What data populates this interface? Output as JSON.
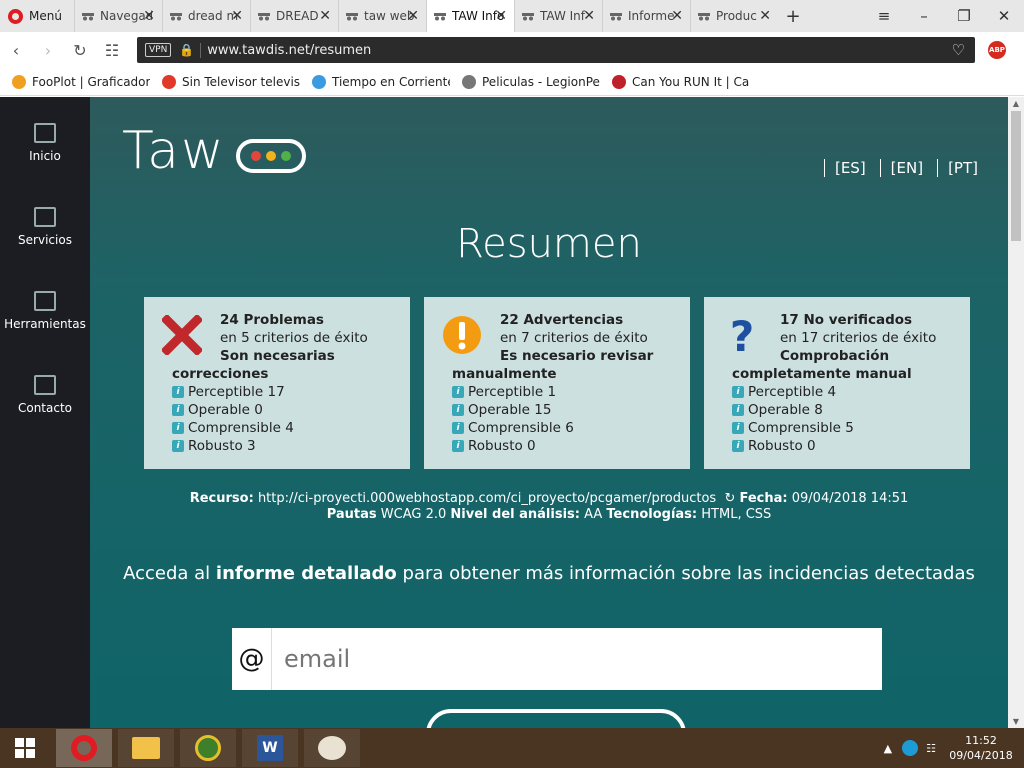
{
  "browser": {
    "menu_label": "Menú",
    "tabs": [
      {
        "title": "Navegador",
        "active": false
      },
      {
        "title": "dread m",
        "active": false
      },
      {
        "title": "DREAD",
        "active": false
      },
      {
        "title": "taw web",
        "active": false
      },
      {
        "title": "TAW Info",
        "active": true
      },
      {
        "title": "TAW Inf",
        "active": false
      },
      {
        "title": "Informe",
        "active": false
      },
      {
        "title": "Produc",
        "active": false
      }
    ],
    "new_tab": "+",
    "url": "www.tawdis.net/resumen",
    "vpn_label": "VPN",
    "abp_label": "ABP",
    "bookmarks": [
      {
        "label": "FooPlot | Graficador d",
        "color": "#f0a020"
      },
      {
        "label": "Sin Televisor televisio",
        "color": "#e23a2a"
      },
      {
        "label": "Tiempo en Corrientes",
        "color": "#3a9be0"
      },
      {
        "label": "Peliculas - LegionPelis",
        "color": "#777777"
      },
      {
        "label": "Can You RUN It | Can",
        "color": "#c0202a"
      }
    ]
  },
  "sidebar": {
    "items": [
      {
        "label": "Inicio"
      },
      {
        "label": "Servicios"
      },
      {
        "label": "Herramientas"
      },
      {
        "label": "Contacto"
      }
    ]
  },
  "logo": {
    "text": "Taw"
  },
  "languages": [
    "[ES]",
    "[EN]",
    "[PT]"
  ],
  "page_title": "Resumen",
  "cards": [
    {
      "icon": "error-x-icon",
      "count_label": "24 Problemas",
      "criteria_label": "en 5 criterios de éxito",
      "note_line1": "Son necesarias",
      "note_line2": "correcciones",
      "criteria": [
        {
          "label": "Perceptible 17"
        },
        {
          "label": "Operable 0"
        },
        {
          "label": "Comprensible 4"
        },
        {
          "label": "Robusto 3"
        }
      ]
    },
    {
      "icon": "warning-icon",
      "count_label": "22 Advertencias",
      "criteria_label": "en 7 criterios de éxito",
      "note_line1": "Es necesario revisar",
      "note_line2": "manualmente",
      "criteria": [
        {
          "label": "Perceptible 1"
        },
        {
          "label": "Operable 15"
        },
        {
          "label": "Comprensible 6"
        },
        {
          "label": "Robusto 0"
        }
      ]
    },
    {
      "icon": "question-icon",
      "count_label": "17 No verificados",
      "criteria_label": "en 17 criterios de éxito",
      "note_line1": "Comprobación",
      "note_line2": "completamente manual",
      "criteria": [
        {
          "label": "Perceptible 4"
        },
        {
          "label": "Operable 8"
        },
        {
          "label": "Comprensible 5"
        },
        {
          "label": "Robusto 0"
        }
      ]
    }
  ],
  "meta": {
    "resource_label": "Recurso:",
    "resource_url": "http://ci-proyecti.000webhostapp.com/ci_proyecto/pcgamer/productos",
    "date_label": "Fecha:",
    "date_value": "09/04/2018 14:51",
    "guidelines_label": "Pautas",
    "guidelines_value": "WCAG 2.0",
    "level_label": "Nivel del análisis:",
    "level_value": "AA",
    "tech_label": "Tecnologías:",
    "tech_value": "HTML, CSS"
  },
  "cta": {
    "prefix": "Acceda al",
    "bold": "informe detallado",
    "suffix": "para obtener más información sobre las incidencias detectadas"
  },
  "email": {
    "at": "@",
    "placeholder": "email"
  },
  "taskbar": {
    "time": "11:52",
    "date": "09/04/2018"
  },
  "colors": {
    "error": "#c0282c",
    "warning": "#f39c12",
    "question": "#1f4fa0",
    "main_bg": "#0f6468",
    "sidebar_bg": "#1b1d22"
  }
}
